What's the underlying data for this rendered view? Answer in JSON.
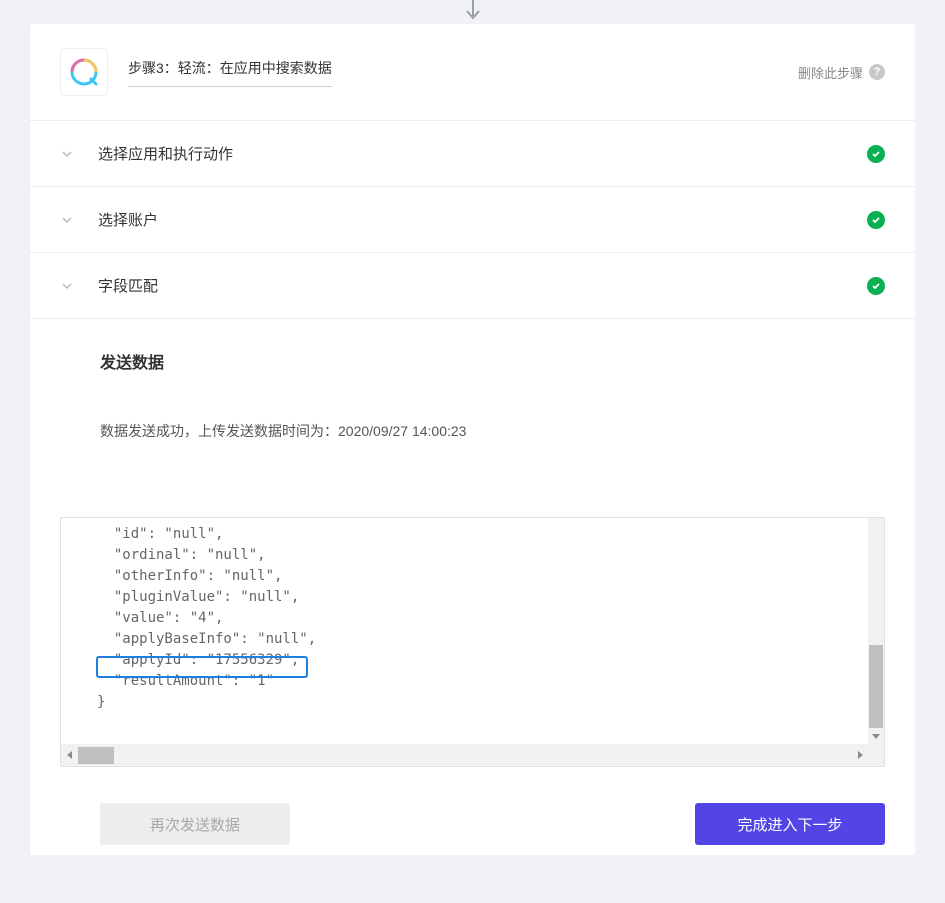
{
  "header": {
    "step_title": "步骤3：轻流：在应用中搜索数据",
    "delete_label": "删除此步骤",
    "help_glyph": "?"
  },
  "sections": [
    {
      "label": "选择应用和执行动作",
      "completed": true
    },
    {
      "label": "选择账户",
      "completed": true
    },
    {
      "label": "字段匹配",
      "completed": true
    }
  ],
  "send": {
    "title": "发送数据",
    "message": "数据发送成功，上传发送数据时间为：2020/09/27 14:00:23"
  },
  "code": {
    "lines": [
      {
        "indent": 2,
        "text": "\"id\": \"null\","
      },
      {
        "indent": 2,
        "text": "\"ordinal\": \"null\","
      },
      {
        "indent": 2,
        "text": "\"otherInfo\": \"null\","
      },
      {
        "indent": 2,
        "text": "\"pluginValue\": \"null\","
      },
      {
        "indent": 2,
        "text": "\"value\": \"4\","
      },
      {
        "indent": 2,
        "text": "\"applyBaseInfo\": \"null\","
      },
      {
        "indent": 2,
        "text": "\"applyId\": \"17556329\","
      },
      {
        "indent": 2,
        "text": "\"resultAmount\": \"1\""
      },
      {
        "indent": 1,
        "text": "}"
      }
    ],
    "highlight_index": 6
  },
  "buttons": {
    "resend": "再次发送数据",
    "next": "完成进入下一步"
  }
}
